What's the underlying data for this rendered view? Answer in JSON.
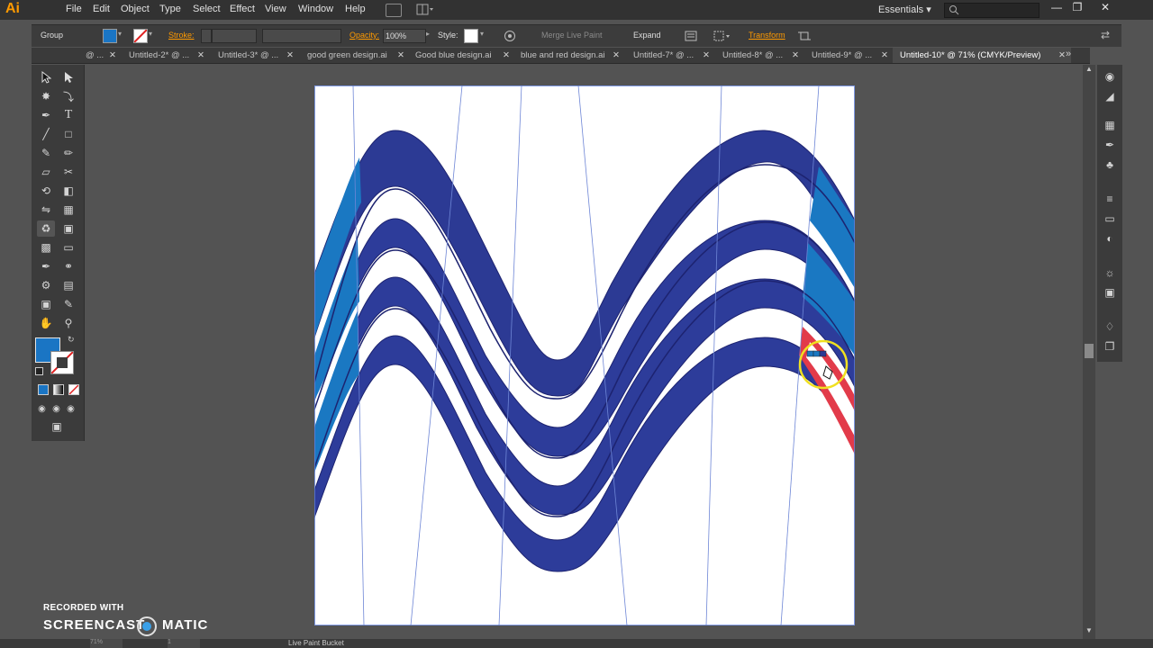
{
  "app": {
    "logo": "Ai"
  },
  "menu": [
    "File",
    "Edit",
    "Object",
    "Type",
    "Select",
    "Effect",
    "View",
    "Window",
    "Help"
  ],
  "workspace": {
    "label": "Essentials ▾"
  },
  "control": {
    "selection": "Group",
    "stroke_label": "Stroke:",
    "opacity_label": "Opacity:",
    "opacity_value": "100%",
    "style_label": "Style:",
    "merge_label": "Merge Live Paint",
    "expand_label": "Expand",
    "transform_label": "Transform"
  },
  "tabs": [
    {
      "label": "@ ..."
    },
    {
      "label": "Untitled-2* @ ..."
    },
    {
      "label": "Untitled-3* @ ..."
    },
    {
      "label": "good green design.ai"
    },
    {
      "label": "Good blue design.ai"
    },
    {
      "label": "blue and red design.ai"
    },
    {
      "label": "Untitled-7* @ ..."
    },
    {
      "label": "Untitled-8* @ ..."
    },
    {
      "label": "Untitled-9* @ ..."
    },
    {
      "label": "Untitled-10* @ 71% (CMYK/Preview)"
    }
  ],
  "colors": {
    "fill": "#1a75c4",
    "navy": "#2c2f8a",
    "midblue": "#3a4aa8",
    "lightblue": "#1a78c2",
    "red": "#e23b4a"
  },
  "status": {
    "zoom": "71%",
    "page": "1",
    "tool": "Live Paint Bucket"
  },
  "watermark": {
    "line1": "RECORDED WITH",
    "line2": "SCREENCAST",
    "line3": "MATIC"
  }
}
